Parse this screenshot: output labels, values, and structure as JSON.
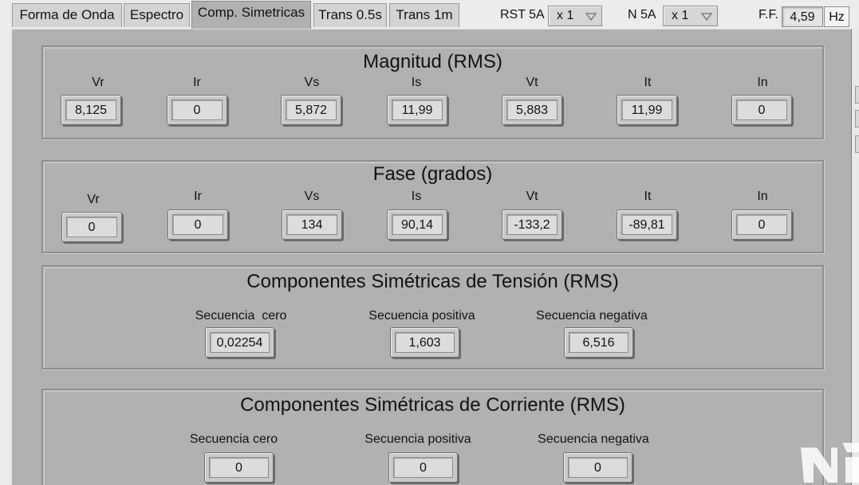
{
  "tabs": [
    {
      "label": "Forma de Onda"
    },
    {
      "label": "Espectro"
    },
    {
      "label": "Comp. Simetricas"
    },
    {
      "label": "Trans 0.5s"
    },
    {
      "label": "Trans 1m"
    }
  ],
  "active_tab": "Comp. Simetricas",
  "controls": {
    "rst_label": "RST 5A",
    "rst_value": "x 1",
    "n_label": "N 5A",
    "n_value": "x 1",
    "ff_label": "F.F.",
    "ff_value": "4,59",
    "hz_label": "Hz"
  },
  "magnitude": {
    "title": "Magnitud (RMS)",
    "items": [
      {
        "label": "Vr",
        "value": "8,125"
      },
      {
        "label": "Ir",
        "value": "0"
      },
      {
        "label": "Vs",
        "value": "5,872"
      },
      {
        "label": "Is",
        "value": "11,99"
      },
      {
        "label": "Vt",
        "value": "5,883"
      },
      {
        "label": "It",
        "value": "11,99"
      },
      {
        "label": "In",
        "value": "0"
      }
    ]
  },
  "phase": {
    "title": "Fase (grados)",
    "items": [
      {
        "label": "Vr",
        "value": "0"
      },
      {
        "label": "Ir",
        "value": "0"
      },
      {
        "label": "Vs",
        "value": "134"
      },
      {
        "label": "Is",
        "value": "90,14"
      },
      {
        "label": "Vt",
        "value": "-133,2"
      },
      {
        "label": "It",
        "value": "-89,81"
      },
      {
        "label": "In",
        "value": "0"
      }
    ]
  },
  "voltage_sym": {
    "title": "Componentes Simétricas de Tensión (RMS)",
    "items": [
      {
        "label": "Secuencia  cero",
        "value": "0,02254"
      },
      {
        "label": "Secuencia positiva",
        "value": "1,603"
      },
      {
        "label": "Secuencia negativa",
        "value": "6,516"
      }
    ]
  },
  "current_sym": {
    "title": "Componentes Simétricas de Corriente (RMS)",
    "items": [
      {
        "label": "Secuencia cero",
        "value": "0"
      },
      {
        "label": "Secuencia positiva",
        "value": "0"
      },
      {
        "label": "Secuencia negativa",
        "value": "0"
      }
    ]
  },
  "colors": {
    "panel": "#b1b1b1",
    "window": "#ececec",
    "indicator": "#dcdcdc",
    "watermark": "#ffffff"
  },
  "icons": {
    "dropdown": "triangle-down-icon",
    "watermark": "ni-logo-icon"
  }
}
